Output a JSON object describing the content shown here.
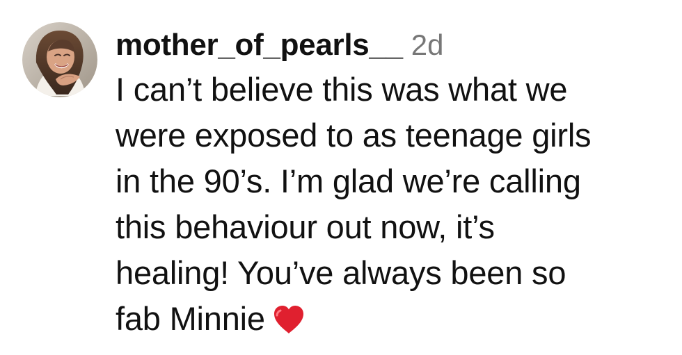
{
  "comment": {
    "username": "mother_of_pearls__",
    "time": "2d",
    "lines": [
      "I can’t believe this was what we",
      "were exposed to as teenage girls",
      "in the 90’s. I’m glad we’re calling",
      "this behaviour out now, it’s",
      "healing! You’ve always been so",
      "fab Minnie"
    ],
    "emoji": "❤️",
    "avatar": "profile-photo",
    "heart_color": "#e0202f"
  }
}
